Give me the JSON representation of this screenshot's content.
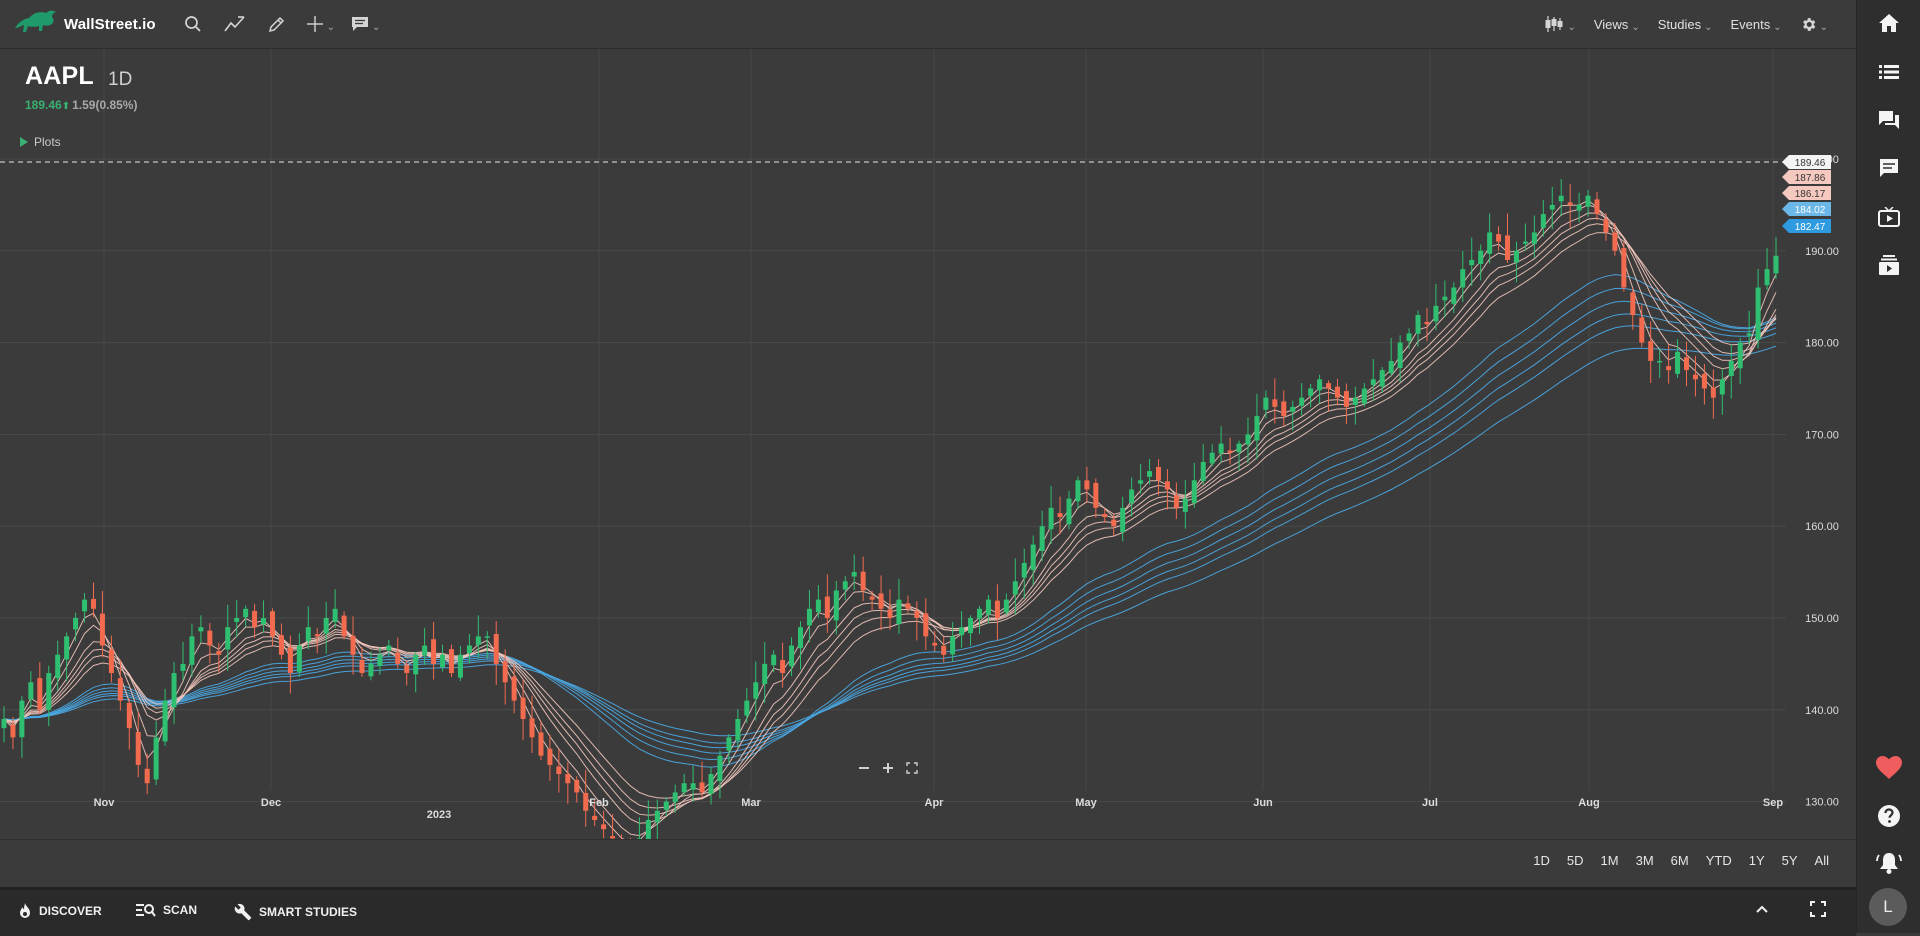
{
  "brand": {
    "name": "WallStreet.io"
  },
  "toolbar": {
    "views_label": "Views",
    "studies_label": "Studies",
    "events_label": "Events"
  },
  "symbol": {
    "ticker": "AAPL",
    "interval": "1D",
    "price": "189.46",
    "change": "1.59(0.85%)",
    "plots_label": "Plots"
  },
  "chart_data": {
    "type": "candlestick",
    "symbol": "AAPL",
    "ylim": [
      122,
      202
    ],
    "y_ticks": [
      "130.00",
      "140.00",
      "150.00",
      "160.00",
      "170.00",
      "180.00",
      "190.00",
      "200.00"
    ],
    "x_ticks": [
      "Nov",
      "Dec",
      "2023",
      "Feb",
      "Mar",
      "Apr",
      "May",
      "Jun",
      "Jul",
      "Aug",
      "Sep"
    ],
    "last_price": 189.46,
    "label_values": [
      "189.46",
      "187.86",
      "186.17",
      "184.02",
      "182.47"
    ],
    "up_color": "#2fbf71",
    "down_color": "#f26b4f",
    "fast_ma_color": "#f2c6bd",
    "slow_ma_color": "#4aa7e0",
    "closes": [
      139,
      137,
      141,
      143,
      140,
      144,
      146,
      148,
      150,
      152,
      151,
      147,
      144,
      141,
      138,
      134,
      132,
      137,
      141,
      144,
      145,
      148,
      149,
      147,
      146,
      149,
      150,
      151,
      149,
      150,
      148,
      146,
      144,
      147,
      149,
      148,
      150,
      151,
      148,
      146,
      144,
      145,
      146,
      147,
      145,
      144,
      146,
      147,
      145,
      146,
      144,
      146,
      147,
      148,
      148,
      145,
      143,
      141,
      139,
      137,
      135,
      134,
      133,
      132,
      131,
      129,
      128,
      127,
      126,
      125,
      125,
      126,
      128,
      129,
      130,
      131,
      132,
      132,
      131,
      133,
      135,
      137,
      139,
      141,
      143,
      145,
      146,
      144,
      147,
      149,
      151,
      152,
      150,
      153,
      154,
      155,
      153,
      152,
      151,
      150,
      152,
      151,
      150,
      148,
      147,
      146,
      148,
      149,
      150,
      151,
      152,
      150,
      152,
      154,
      156,
      158,
      160,
      162,
      161,
      163,
      165,
      164,
      162,
      161,
      160,
      162,
      164,
      165,
      166,
      165,
      164,
      162,
      163,
      165,
      167,
      168,
      169,
      168,
      169,
      170,
      172,
      174,
      173,
      172,
      173,
      174,
      175,
      176,
      175,
      174,
      173,
      174,
      175,
      176,
      177,
      178,
      180,
      181,
      183,
      182,
      184,
      185,
      186,
      188,
      189,
      190,
      192,
      191,
      189,
      190,
      191,
      192,
      194,
      195,
      196,
      195,
      195,
      196,
      194,
      192,
      190,
      186,
      183,
      180,
      178,
      178,
      177,
      179,
      177,
      176,
      175,
      174,
      176,
      178,
      180,
      181,
      186,
      188,
      189.46
    ]
  },
  "zoom": {
    "minus": "−",
    "plus": "+"
  },
  "ranges": [
    "1D",
    "5D",
    "1M",
    "3M",
    "6M",
    "YTD",
    "1Y",
    "5Y",
    "All"
  ],
  "bottom": {
    "discover_label": "DISCOVER",
    "scan_label": "SCAN",
    "smart_studies_label": "SMART STUDIES"
  },
  "user": {
    "avatar_letter": "L"
  }
}
